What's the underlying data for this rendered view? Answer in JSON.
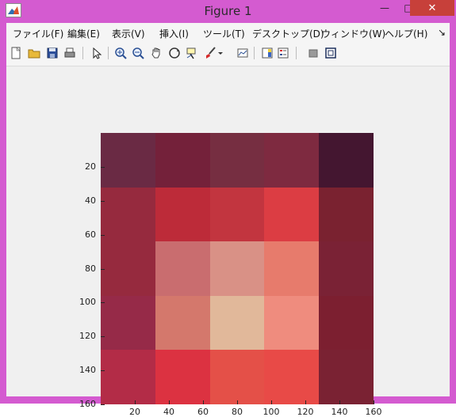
{
  "window": {
    "title": "Figure 1",
    "buttons": {
      "minimize": "—",
      "maximize": "□",
      "close": "✕"
    }
  },
  "menubar": {
    "items": [
      "ファイル(F)",
      "編集(E)",
      "表示(V)",
      "挿入(I)",
      "ツール(T)",
      "デスクトップ(D)",
      "ウィンドウ(W)",
      "ヘルプ(H)"
    ],
    "overflow": "↘"
  },
  "toolbar": {
    "icons": [
      "new-figure-icon",
      "open-file-icon",
      "save-icon",
      "print-icon",
      "pointer-icon",
      "zoom-in-icon",
      "zoom-out-icon",
      "pan-icon",
      "rotate-3d-icon",
      "data-cursor-icon",
      "brush-icon",
      "brush-dropdown-icon",
      "link-plot-icon",
      "colorbar-icon",
      "legend-icon",
      "hide-plot-tools-icon",
      "show-plot-tools-icon"
    ]
  },
  "chart_data": {
    "type": "heatmap",
    "title": "",
    "xlabel": "",
    "ylabel": "",
    "xlim": [
      0,
      160
    ],
    "ylim": [
      0,
      160
    ],
    "y_reversed": true,
    "xticks": [
      "20",
      "40",
      "60",
      "80",
      "100",
      "120",
      "140",
      "160"
    ],
    "yticks": [
      "20",
      "40",
      "60",
      "80",
      "100",
      "120",
      "140",
      "160"
    ],
    "grid": false,
    "colors": [
      [
        "#6a2a44",
        "#74213a",
        "#762e41",
        "#7e2a40",
        "#441630"
      ],
      [
        "#962a3e",
        "#bd2b39",
        "#c2353f",
        "#dc3d43",
        "#7a2230"
      ],
      [
        "#962a3e",
        "#c96d6f",
        "#d99186",
        "#e77b6c",
        "#7a2235"
      ],
      [
        "#962a48",
        "#d4786c",
        "#e1b89a",
        "#ef8c7e",
        "#7c1f30"
      ],
      [
        "#b32c47",
        "#dc3241",
        "#e45048",
        "#e84a47",
        "#7a2233"
      ]
    ]
  }
}
